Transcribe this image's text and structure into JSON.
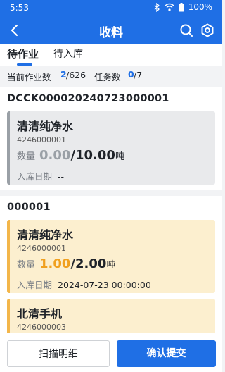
{
  "status": {
    "time": "5:53",
    "battery": "100%"
  },
  "header": {
    "title": "收料"
  },
  "tabs": [
    {
      "label": "待作业"
    },
    {
      "label": "待入库"
    }
  ],
  "summary": {
    "job_label": "当前作业数",
    "job_done": "2",
    "job_total": "/626",
    "task_label": "任务数",
    "task_done": "0",
    "task_total": "/7"
  },
  "groups": [
    {
      "title": "DCCK000020240723000001",
      "cards": [
        {
          "name": "清清纯净水",
          "code": "4246000001",
          "qty_label": "数量",
          "qty_done": "0.00",
          "qty_total": "/10.00",
          "unit": "吨",
          "date_label": "入库日期",
          "date": "--"
        }
      ]
    },
    {
      "title": "000001",
      "cards": [
        {
          "name": "清清纯净水",
          "code": "4246000001",
          "qty_label": "数量",
          "qty_done": "1.00",
          "qty_total": "/2.00",
          "unit": "吨",
          "date_label": "入库日期",
          "date": "2024-07-23 00:00:00"
        },
        {
          "name": "北清手机",
          "code": "4246000003"
        }
      ]
    }
  ],
  "footer": {
    "scan_label": "扫描明细",
    "submit_label": "确认提交"
  },
  "colors": {
    "primary": "#1f6fe5",
    "warning": "#f3b64a",
    "done_gray": "#9aa0a6",
    "done_orange": "#f0a020"
  }
}
